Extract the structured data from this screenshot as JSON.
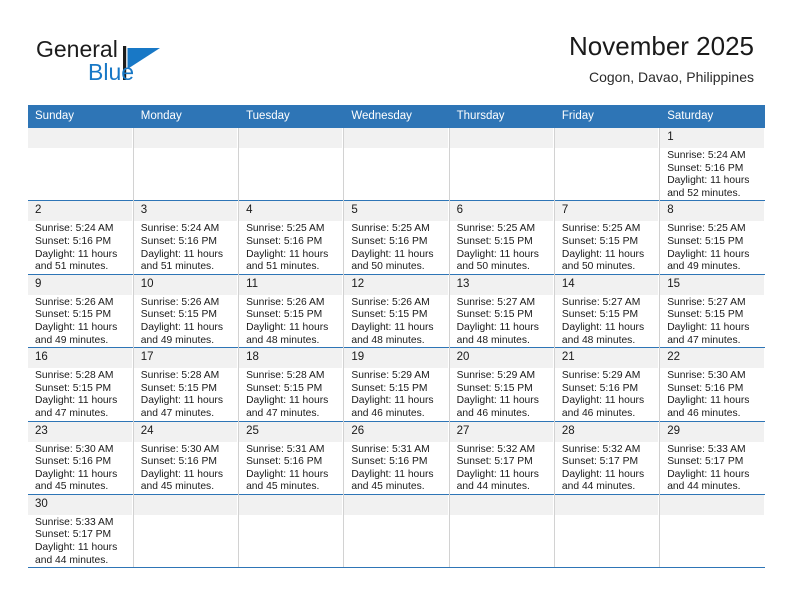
{
  "brand": {
    "word_one": "General",
    "word_two": "Blue",
    "mark_color": "#1878c6",
    "text_color": "#1c1c1c"
  },
  "header": {
    "title": "November 2025",
    "subtitle": "Cogon, Davao, Philippines",
    "accent_color": "#2e75b6"
  },
  "calendar": {
    "weekday_headers": [
      "Sunday",
      "Monday",
      "Tuesday",
      "Wednesday",
      "Thursday",
      "Friday",
      "Saturday"
    ],
    "weeks": [
      [
        {
          "day": "",
          "blank": true,
          "lines": []
        },
        {
          "day": "",
          "blank": true,
          "lines": []
        },
        {
          "day": "",
          "blank": true,
          "lines": []
        },
        {
          "day": "",
          "blank": true,
          "lines": []
        },
        {
          "day": "",
          "blank": true,
          "lines": []
        },
        {
          "day": "",
          "blank": true,
          "lines": []
        },
        {
          "day": "1",
          "blank": false,
          "lines": [
            "Sunrise: 5:24 AM",
            "Sunset: 5:16 PM",
            "Daylight: 11 hours",
            "and 52 minutes."
          ]
        }
      ],
      [
        {
          "day": "2",
          "blank": false,
          "lines": [
            "Sunrise: 5:24 AM",
            "Sunset: 5:16 PM",
            "Daylight: 11 hours",
            "and 51 minutes."
          ]
        },
        {
          "day": "3",
          "blank": false,
          "lines": [
            "Sunrise: 5:24 AM",
            "Sunset: 5:16 PM",
            "Daylight: 11 hours",
            "and 51 minutes."
          ]
        },
        {
          "day": "4",
          "blank": false,
          "lines": [
            "Sunrise: 5:25 AM",
            "Sunset: 5:16 PM",
            "Daylight: 11 hours",
            "and 51 minutes."
          ]
        },
        {
          "day": "5",
          "blank": false,
          "lines": [
            "Sunrise: 5:25 AM",
            "Sunset: 5:16 PM",
            "Daylight: 11 hours",
            "and 50 minutes."
          ]
        },
        {
          "day": "6",
          "blank": false,
          "lines": [
            "Sunrise: 5:25 AM",
            "Sunset: 5:15 PM",
            "Daylight: 11 hours",
            "and 50 minutes."
          ]
        },
        {
          "day": "7",
          "blank": false,
          "lines": [
            "Sunrise: 5:25 AM",
            "Sunset: 5:15 PM",
            "Daylight: 11 hours",
            "and 50 minutes."
          ]
        },
        {
          "day": "8",
          "blank": false,
          "lines": [
            "Sunrise: 5:25 AM",
            "Sunset: 5:15 PM",
            "Daylight: 11 hours",
            "and 49 minutes."
          ]
        }
      ],
      [
        {
          "day": "9",
          "blank": false,
          "lines": [
            "Sunrise: 5:26 AM",
            "Sunset: 5:15 PM",
            "Daylight: 11 hours",
            "and 49 minutes."
          ]
        },
        {
          "day": "10",
          "blank": false,
          "lines": [
            "Sunrise: 5:26 AM",
            "Sunset: 5:15 PM",
            "Daylight: 11 hours",
            "and 49 minutes."
          ]
        },
        {
          "day": "11",
          "blank": false,
          "lines": [
            "Sunrise: 5:26 AM",
            "Sunset: 5:15 PM",
            "Daylight: 11 hours",
            "and 48 minutes."
          ]
        },
        {
          "day": "12",
          "blank": false,
          "lines": [
            "Sunrise: 5:26 AM",
            "Sunset: 5:15 PM",
            "Daylight: 11 hours",
            "and 48 minutes."
          ]
        },
        {
          "day": "13",
          "blank": false,
          "lines": [
            "Sunrise: 5:27 AM",
            "Sunset: 5:15 PM",
            "Daylight: 11 hours",
            "and 48 minutes."
          ]
        },
        {
          "day": "14",
          "blank": false,
          "lines": [
            "Sunrise: 5:27 AM",
            "Sunset: 5:15 PM",
            "Daylight: 11 hours",
            "and 48 minutes."
          ]
        },
        {
          "day": "15",
          "blank": false,
          "lines": [
            "Sunrise: 5:27 AM",
            "Sunset: 5:15 PM",
            "Daylight: 11 hours",
            "and 47 minutes."
          ]
        }
      ],
      [
        {
          "day": "16",
          "blank": false,
          "lines": [
            "Sunrise: 5:28 AM",
            "Sunset: 5:15 PM",
            "Daylight: 11 hours",
            "and 47 minutes."
          ]
        },
        {
          "day": "17",
          "blank": false,
          "lines": [
            "Sunrise: 5:28 AM",
            "Sunset: 5:15 PM",
            "Daylight: 11 hours",
            "and 47 minutes."
          ]
        },
        {
          "day": "18",
          "blank": false,
          "lines": [
            "Sunrise: 5:28 AM",
            "Sunset: 5:15 PM",
            "Daylight: 11 hours",
            "and 47 minutes."
          ]
        },
        {
          "day": "19",
          "blank": false,
          "lines": [
            "Sunrise: 5:29 AM",
            "Sunset: 5:15 PM",
            "Daylight: 11 hours",
            "and 46 minutes."
          ]
        },
        {
          "day": "20",
          "blank": false,
          "lines": [
            "Sunrise: 5:29 AM",
            "Sunset: 5:15 PM",
            "Daylight: 11 hours",
            "and 46 minutes."
          ]
        },
        {
          "day": "21",
          "blank": false,
          "lines": [
            "Sunrise: 5:29 AM",
            "Sunset: 5:16 PM",
            "Daylight: 11 hours",
            "and 46 minutes."
          ]
        },
        {
          "day": "22",
          "blank": false,
          "lines": [
            "Sunrise: 5:30 AM",
            "Sunset: 5:16 PM",
            "Daylight: 11 hours",
            "and 46 minutes."
          ]
        }
      ],
      [
        {
          "day": "23",
          "blank": false,
          "lines": [
            "Sunrise: 5:30 AM",
            "Sunset: 5:16 PM",
            "Daylight: 11 hours",
            "and 45 minutes."
          ]
        },
        {
          "day": "24",
          "blank": false,
          "lines": [
            "Sunrise: 5:30 AM",
            "Sunset: 5:16 PM",
            "Daylight: 11 hours",
            "and 45 minutes."
          ]
        },
        {
          "day": "25",
          "blank": false,
          "lines": [
            "Sunrise: 5:31 AM",
            "Sunset: 5:16 PM",
            "Daylight: 11 hours",
            "and 45 minutes."
          ]
        },
        {
          "day": "26",
          "blank": false,
          "lines": [
            "Sunrise: 5:31 AM",
            "Sunset: 5:16 PM",
            "Daylight: 11 hours",
            "and 45 minutes."
          ]
        },
        {
          "day": "27",
          "blank": false,
          "lines": [
            "Sunrise: 5:32 AM",
            "Sunset: 5:17 PM",
            "Daylight: 11 hours",
            "and 44 minutes."
          ]
        },
        {
          "day": "28",
          "blank": false,
          "lines": [
            "Sunrise: 5:32 AM",
            "Sunset: 5:17 PM",
            "Daylight: 11 hours",
            "and 44 minutes."
          ]
        },
        {
          "day": "29",
          "blank": false,
          "lines": [
            "Sunrise: 5:33 AM",
            "Sunset: 5:17 PM",
            "Daylight: 11 hours",
            "and 44 minutes."
          ]
        }
      ],
      [
        {
          "day": "30",
          "blank": false,
          "lines": [
            "Sunrise: 5:33 AM",
            "Sunset: 5:17 PM",
            "Daylight: 11 hours",
            "and 44 minutes."
          ]
        },
        {
          "day": "",
          "blank": true,
          "lines": []
        },
        {
          "day": "",
          "blank": true,
          "lines": []
        },
        {
          "day": "",
          "blank": true,
          "lines": []
        },
        {
          "day": "",
          "blank": true,
          "lines": []
        },
        {
          "day": "",
          "blank": true,
          "lines": []
        },
        {
          "day": "",
          "blank": true,
          "lines": []
        }
      ]
    ]
  }
}
